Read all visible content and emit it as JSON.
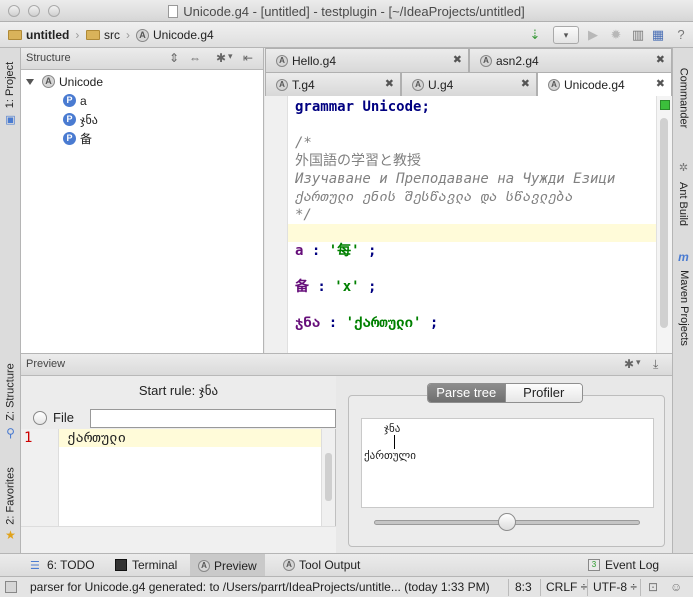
{
  "window": {
    "title": "Unicode.g4 - [untitled] - testplugin - [~/IdeaProjects/untitled]"
  },
  "navbar": {
    "crumbs": [
      "untitled",
      "src",
      "Unicode.g4"
    ]
  },
  "left_stripe": {
    "project": "1: Project",
    "structure": "Z: Structure",
    "favorites": "2: Favorites"
  },
  "right_stripe": {
    "commander": "Commander",
    "ant": "Ant Build",
    "maven": "Maven Projects"
  },
  "structure": {
    "title": "Structure",
    "root": "Unicode",
    "items": [
      {
        "icon": "P",
        "label": "a"
      },
      {
        "icon": "P",
        "label": "ჯნა"
      },
      {
        "icon": "P",
        "label": "备"
      }
    ]
  },
  "editor": {
    "tabs_row1": [
      {
        "label": "Hello.g4"
      },
      {
        "label": "asn2.g4"
      }
    ],
    "tabs_row2": [
      {
        "label": "T.g4"
      },
      {
        "label": "U.g4"
      },
      {
        "label": "Unicode.g4"
      }
    ],
    "code": {
      "grammar_kw": "grammar",
      "grammar_name": "Unicode;",
      "comment_open": "/*",
      "comment_1": "外国語の学習と教授",
      "comment_2": "Изучаване и Преподаване на Чужди Езици",
      "comment_3": "ქართული ენის შესწავლა და სწავლება",
      "comment_close": "*/",
      "rule1_name": "a",
      "rule1_lit": "'每'",
      "rule2_name": "备",
      "rule2_lit": "'x'",
      "rule3_name": "ჯნა",
      "rule3_lit": "'ქართული'",
      "colon": " : ",
      "semi": " ;"
    }
  },
  "preview": {
    "title": "Preview",
    "start_rule": "Start rule: ჯნა",
    "file_label": "File",
    "input_line_number": "1",
    "input_text": "ქართული",
    "seg_parse_tree": "Parse tree",
    "seg_profiler": "Profiler",
    "tree_root": "ჯნა",
    "tree_leaf": "ქართული"
  },
  "bottom_tools": {
    "todo": "6: TODO",
    "terminal": "Terminal",
    "preview": "Preview",
    "tool_output": "Tool Output",
    "event_log": "Event Log"
  },
  "status": {
    "message": "parser for Unicode.g4 generated: to /Users/parrt/IdeaProjects/untitle... (today 1:33 PM)",
    "position": "8:3",
    "line_sep": "CRLF ÷",
    "encoding": "UTF-8 ÷"
  }
}
